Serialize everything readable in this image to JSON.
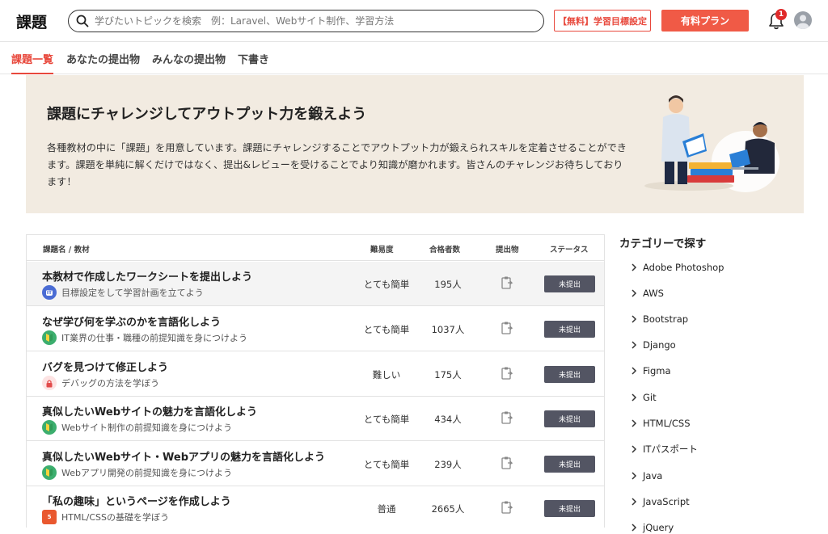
{
  "header": {
    "logo": "課題",
    "search_placeholder": "学びたいトピックを検索　例：Laravel、Webサイト制作、学習方法",
    "goal_button": "【無料】学習目標設定",
    "paid_button": "有料プラン",
    "notification_count": "1"
  },
  "tabs": [
    {
      "label": "課題一覧",
      "active": true
    },
    {
      "label": "あなたの提出物",
      "active": false
    },
    {
      "label": "みんなの提出物",
      "active": false
    },
    {
      "label": "下書き",
      "active": false
    }
  ],
  "hero": {
    "title": "課題にチャレンジしてアウトプット力を鍛えよう",
    "description": "各種教材の中に「課題」を用意しています。課題にチャレンジすることでアウトプット力が鍛えられスキルを定着させることができます。課題を単純に解くだけではなく、提出&レビューを受けることでより知識が磨かれます。皆さんのチャレンジお待ちしております！"
  },
  "table": {
    "headers": {
      "name": "課題名 / 教材",
      "difficulty": "難易度",
      "passed": "合格者数",
      "submission": "提出物",
      "status": "ステータス"
    },
    "rows": [
      {
        "title": "本教材で作成したワークシートを提出しよう",
        "course": "目標設定をして学習計画を立てよう",
        "icon": "it-icon",
        "icon_text": "IT",
        "icon_color": "#4a6cd4",
        "difficulty": "とても簡単",
        "passed": "195人",
        "status": "未提出"
      },
      {
        "title": "なぜ学び何を学ぶのかを言語化しよう",
        "course": "IT業界の仕事・職種の前提知識を身につけよう",
        "icon": "beginner-mark-icon",
        "icon_text": "",
        "icon_color": "#3cae6e",
        "difficulty": "とても簡単",
        "passed": "1037人",
        "status": "未提出"
      },
      {
        "title": "バグを見つけて修正しよう",
        "course": "デバッグの方法を学ぼう",
        "icon": "lock-icon",
        "icon_text": "",
        "icon_color": "#fde3e3",
        "difficulty": "難しい",
        "passed": "175人",
        "status": "未提出"
      },
      {
        "title": "真似したいWebサイトの魅力を言語化しよう",
        "course": "Webサイト制作の前提知識を身につけよう",
        "icon": "beginner-mark-icon",
        "icon_text": "",
        "icon_color": "#3cae6e",
        "difficulty": "とても簡単",
        "passed": "434人",
        "status": "未提出"
      },
      {
        "title": "真似したいWebサイト・Webアプリの魅力を言語化しよう",
        "course": "Webアプリ開発の前提知識を身につけよう",
        "icon": "beginner-mark-icon",
        "icon_text": "",
        "icon_color": "#3cae6e",
        "difficulty": "とても簡単",
        "passed": "239人",
        "status": "未提出"
      },
      {
        "title": "「私の趣味」というページを作成しよう",
        "course": "HTML/CSSの基礎を学ぼう",
        "icon": "html5-icon",
        "icon_text": "5",
        "icon_color": "#e9582f",
        "difficulty": "普通",
        "passed": "2665人",
        "status": "未提出"
      }
    ]
  },
  "categories": {
    "title": "カテゴリーで探す",
    "items": [
      "Adobe Photoshop",
      "AWS",
      "Bootstrap",
      "Django",
      "Figma",
      "Git",
      "HTML/CSS",
      "ITパスポート",
      "Java",
      "JavaScript",
      "jQuery"
    ]
  },
  "colors": {
    "accent": "#e8483c",
    "paid_button": "#f05a46",
    "hero_bg": "#f2ebe1",
    "status_button": "#535563"
  }
}
